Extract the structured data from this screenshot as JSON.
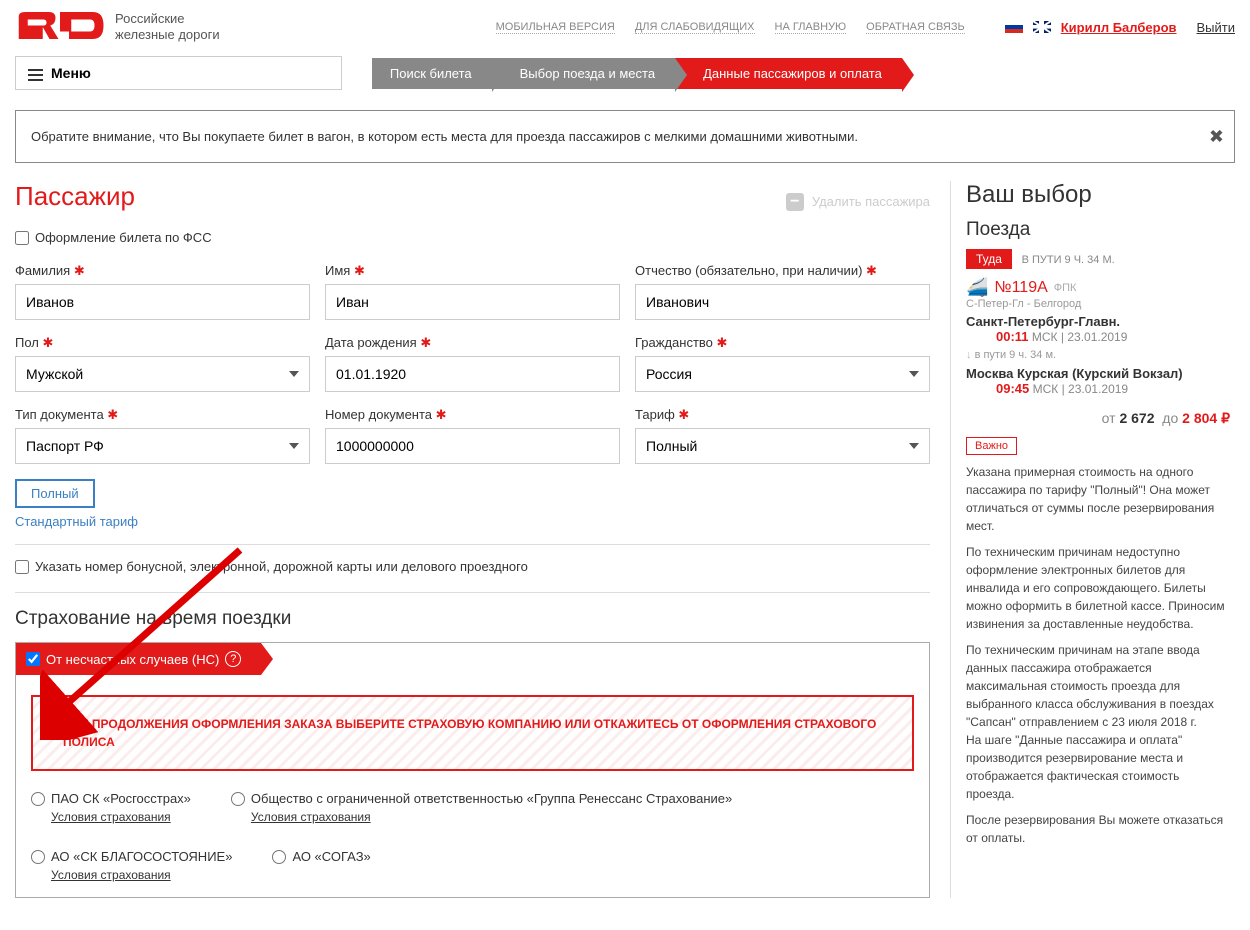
{
  "top": {
    "brand1": "Российские",
    "brand2": "железные дороги",
    "links": [
      "МОБИЛЬНАЯ ВЕРСИЯ",
      "ДЛЯ СЛАБОВИДЯЩИХ",
      "НА ГЛАВНУЮ",
      "ОБРАТНАЯ СВЯЗЬ"
    ],
    "user": "Кирилл Балберов",
    "logout": "Выйти",
    "menu": "Меню"
  },
  "steps": [
    "Поиск билета",
    "Выбор поезда и места",
    "Данные пассажиров и оплата"
  ],
  "notice": "Обратите внимание, что Вы покупаете билет в вагон, в котором есть места для проезда пассажиров с мелкими домашними животными.",
  "pass": {
    "title": "Пассажир",
    "delete": "Удалить пассажира",
    "fss": "Оформление билета по ФСС",
    "labels": {
      "ln": "Фамилия",
      "fn": "Имя",
      "mn": "Отчество (обязательно, при наличии)",
      "sex": "Пол",
      "dob": "Дата рождения",
      "cit": "Гражданство",
      "doctype": "Тип документа",
      "docno": "Номер документа",
      "tariff": "Тариф"
    },
    "vals": {
      "ln": "Иванов",
      "fn": "Иван",
      "mn": "Иванович",
      "sex": "Мужской",
      "dob": "01.01.1920",
      "cit": "Россия",
      "doctype": "Паспорт РФ",
      "docno": "1000000000",
      "tariff": "Полный"
    },
    "tariff_tag": "Полный",
    "tariff_link": "Стандартный тариф",
    "bonus": "Указать номер бонусной, электронной, дорожной карты или делового проездного"
  },
  "ins": {
    "title": "Страхование на время поездки",
    "ribbon": "От несчастных случаев (НС)",
    "warn": "ДЛЯ ПРОДОЛЖЕНИЯ ОФОРМЛЕНИЯ ЗАКАЗА ВЫБЕРИТЕ СТРАХОВУЮ КОМПАНИЮ ИЛИ ОТКАЖИТЕСЬ ОТ ОФОРМЛЕНИЯ СТРАХОВОГО ПОЛИСА",
    "opts": [
      "ПАО СК «Росгосстрах»",
      "Общество с ограниченной ответственностью «Группа Ренессанс Страхование»",
      "АО «СК БЛАГОСОСТОЯНИЕ»",
      "АО «СОГАЗ»"
    ],
    "cond": "Условия страхования"
  },
  "side": {
    "h": "Ваш выбор",
    "sub": "Поезда",
    "dir": "Туда",
    "travel": "В ПУТИ 9 Ч. 34 М.",
    "train_no": "№119А",
    "train_co": "ФПК",
    "route": "С-Петер-Гл - Белгород",
    "dep_city": "Санкт-Петербург-Главн.",
    "dep_time": "00:11",
    "dep_tz": "МСК",
    "dep_date": "23.01.2019",
    "transit": "в пути  9 ч. 34 м.",
    "arr_city": "Москва Курская (Курский Вокзал)",
    "arr_time": "09:45",
    "arr_tz": "МСК",
    "arr_date": "23.01.2019",
    "price_from": "от",
    "price1": "2 672",
    "price_to": "до",
    "price2": "2 804",
    "important": "Важно",
    "note1": "Указана примерная стоимость на одного пассажира по тарифу \"Полный\"! Она может отличаться от суммы после резервирования мест.",
    "note2": "По техническим причинам недоступно оформление электронных билетов для инвалида и его сопровождающего. Билеты можно оформить в билетной кассе. Приносим извинения за доставленные неудобства.",
    "note3": "По техническим причинам на этапе ввода данных пассажира отображается максимальная стоимость проезда для выбранного класса обслуживания в поездах \"Сапсан\" отправлением с 23 июля 2018 г.\nНа шаге \"Данные пассажира и оплата\" производится резервирование места и отображается фактическая стоимость проезда.",
    "note4": "После резервирования Вы можете отказаться от оплаты."
  }
}
